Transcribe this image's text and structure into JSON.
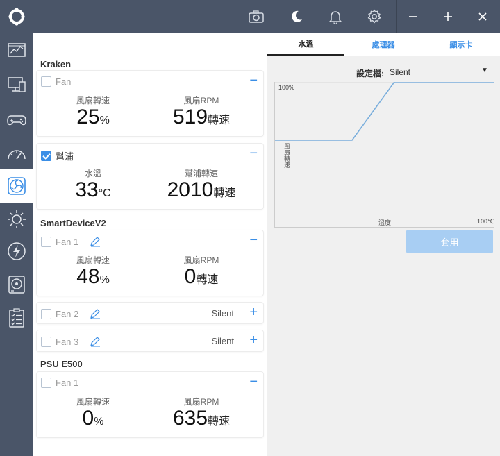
{
  "sidebar": {
    "items": [
      "dashboard",
      "devices",
      "gaming",
      "performance",
      "cooling",
      "lighting",
      "power",
      "storage",
      "checklist"
    ],
    "active_index": 4
  },
  "topbar": {
    "icons": [
      "camera-icon",
      "moon-icon",
      "bell-icon",
      "gear-icon"
    ],
    "window": [
      "minimize",
      "maximize",
      "close"
    ]
  },
  "groups": {
    "kraken": {
      "title": "Kraken",
      "fan": {
        "label": "Fan",
        "checked": false,
        "m1": {
          "label": "風扇轉速",
          "value": "25",
          "unit": "%"
        },
        "m2": {
          "label": "風扇RPM",
          "value": "519",
          "unit": "轉速"
        }
      },
      "pump": {
        "label": "幫浦",
        "checked": true,
        "m1": {
          "label": "水溫",
          "value": "33",
          "unit": "°C"
        },
        "m2": {
          "label": "幫浦轉速",
          "value": "2010",
          "unit": "轉速"
        }
      }
    },
    "smartdevice": {
      "title": "SmartDeviceV2",
      "fan1": {
        "label": "Fan 1",
        "m1": {
          "label": "風扇轉速",
          "value": "48",
          "unit": "%"
        },
        "m2": {
          "label": "風扇RPM",
          "value": "0",
          "unit": "轉速"
        }
      },
      "fan2": {
        "label": "Fan 2",
        "mode": "Silent"
      },
      "fan3": {
        "label": "Fan 3",
        "mode": "Silent"
      }
    },
    "psu": {
      "title": "PSU E500",
      "fan1": {
        "label": "Fan 1",
        "m1": {
          "label": "風扇轉速",
          "value": "0",
          "unit": "%"
        },
        "m2": {
          "label": "風扇RPM",
          "value": "635",
          "unit": "轉速"
        }
      }
    }
  },
  "right": {
    "tabs": [
      "水溫",
      "處理器",
      "顯示卡"
    ],
    "active_tab": 0,
    "profile_label": "設定檔:",
    "profile_value": "Silent",
    "chart": {
      "y_max_label": "100%",
      "y_label": "風扇轉速",
      "x_label": "溫度",
      "x_max_label": "100℃"
    },
    "apply": "套用"
  },
  "colors": {
    "sidebar": "#4a5568",
    "accent": "#3a8ee6",
    "curve": "#7aaedc",
    "apply": "#a8cef3"
  }
}
